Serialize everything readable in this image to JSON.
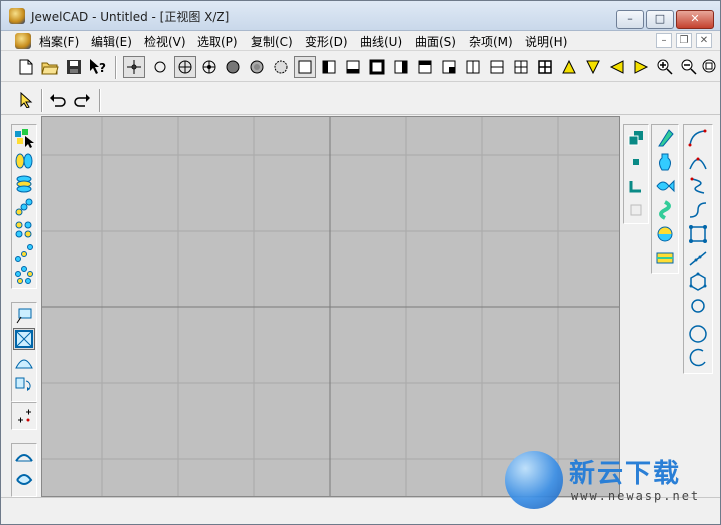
{
  "window": {
    "title": "JewelCAD - Untitled - [正视图 X/Z]",
    "controls": {
      "minimize": "–",
      "maximize": "□",
      "close": "✕"
    }
  },
  "menubar": {
    "items": [
      "档案(F)",
      "编辑(E)",
      "检视(V)",
      "选取(P)",
      "复制(C)",
      "变形(D)",
      "曲线(U)",
      "曲面(S)",
      "杂项(M)",
      "说明(H)"
    ],
    "mdi_controls": {
      "minimize": "–",
      "restore": "❐",
      "close": "✕"
    }
  },
  "toolbar_main": {
    "buttons": [
      "new-file-icon",
      "open-folder-icon",
      "save-disk-icon",
      "help-pointer-icon",
      "pick-point-icon",
      "circle-icon",
      "circle-cross-icon",
      "circle-plus-icon",
      "filled-circle-icon",
      "gray-circle-icon",
      "dashed-circle-icon",
      "square-view-icon",
      "left-half-view-icon",
      "bottom-view-icon",
      "thick-square-icon",
      "right-half-view-icon",
      "top-view-icon",
      "top-left-view-icon",
      "vertical-split-icon",
      "horizontal-split-icon",
      "grid-four-icon",
      "grid-four-alt-icon",
      "triangle-up-icon",
      "triangle-down-icon",
      "triangle-left-icon",
      "triangle-right-icon",
      "zoom-in-icon",
      "zoom-out-icon",
      "zoom-fit-icon"
    ]
  },
  "toolbar_secondary": {
    "buttons": [
      "select-arrow-icon",
      "undo-icon",
      "redo-icon"
    ]
  },
  "left_tools": [
    [
      "select-multi-icon",
      "mirror-icon",
      "stack-icon",
      "array-icon",
      "group-icon",
      "scatter-icon",
      "ring-array-icon"
    ],
    [
      "view-box-icon",
      "frame-icon",
      "dome-icon",
      "rotate-icon"
    ],
    [
      "points-icon"
    ],
    [
      "arc-icon",
      "curve-loop-icon"
    ]
  ],
  "right_tools_a": [
    "copy-objects-icon",
    "dot-icon",
    "corner-icon",
    "blank-square-icon"
  ],
  "right_tools_b": [
    "nib-icon",
    "vase-icon",
    "fish-icon",
    "spiral-surface-icon",
    "shell-icon",
    "strip-icon"
  ],
  "right_tools_c": [
    "curve-open-icon",
    "curve-bridge-icon",
    "curve-s-icon",
    "curve-step-icon",
    "curve-node-box-icon",
    "polyline-icon",
    "closed-curve-icon",
    "small-circle-icon",
    "large-circle-icon",
    "arc-curve-icon"
  ],
  "watermark": {
    "title": "新云下载",
    "url": "www.newasp.net"
  },
  "colors": {
    "canvas": "#c0c0c0",
    "grid_minor": "#a9a9a9",
    "grid_major": "#7a7a7a",
    "accent": "#2a7fd6"
  }
}
